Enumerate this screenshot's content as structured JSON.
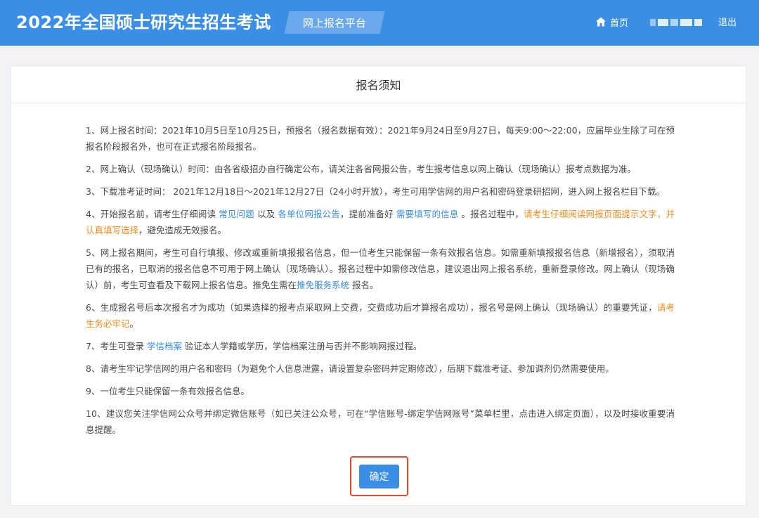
{
  "header": {
    "site_title": "2022年全国硕士研究生招生考试",
    "platform_label": "网上报名平台",
    "home_label": "首页",
    "logout_label": "退出"
  },
  "notice": {
    "title": "报名须知",
    "items": [
      {
        "segments": [
          {
            "text": "1、网上报名时间：2021年10月5日至10月25日，预报名（报名数据有效）：2021年9月24日至9月27日，每天9:00～22:00，应届毕业生除了可在预报名阶段报名外，也可在正式报名阶段报名。"
          }
        ]
      },
      {
        "segments": [
          {
            "text": "2、网上确认（现场确认）时间：由各省级招办自行确定公布，请关注各省网报公告，考生报考信息以网上确认（现场确认）报考点数据为准。"
          }
        ]
      },
      {
        "segments": [
          {
            "text": "3、下载准考证时间： 2021年12月18日～2021年12月27日（24小时开放），考生可用学信网的用户名和密码登录研招网，进入网上报名栏目下载。"
          }
        ]
      },
      {
        "segments": [
          {
            "text": "4、开始报名前，请考生仔细阅读 "
          },
          {
            "text": "常见问题",
            "type": "link"
          },
          {
            "text": " 以及 "
          },
          {
            "text": "各单位网报公告",
            "type": "link"
          },
          {
            "text": "，提前准备好 "
          },
          {
            "text": "需要填写的信息",
            "type": "link"
          },
          {
            "text": " 。报名过程中，"
          },
          {
            "text": "请考生仔细阅读网报页面提示文字，并认真填写选择",
            "type": "warn"
          },
          {
            "text": "，避免造成无效报名。"
          }
        ]
      },
      {
        "segments": [
          {
            "text": "5、网上报名期间，考生可自行填报、修改或重新填报报名信息，但一位考生只能保留一条有效报名信息。如需重新填报报名信息（新增报名），须取消已有的报名，已取消的报名信息不可用于网上确认（现场确认）。报名过程中如需修改信息，建议退出网上报名系统，重新登录修改。网上确认（现场确认）前，考生可查看及下载网上报名信息。推免生需在"
          },
          {
            "text": "推免服务系统",
            "type": "link"
          },
          {
            "text": " 报名。"
          }
        ]
      },
      {
        "segments": [
          {
            "text": "6、生成报名号后本次报名才为成功（如果选择的报考点采取网上交费，交费成功后才算报名成功），报名号是网上确认（现场确认）的重要凭证，"
          },
          {
            "text": "请考生务必牢记",
            "type": "warn"
          },
          {
            "text": "。"
          }
        ]
      },
      {
        "segments": [
          {
            "text": "7、考生可登录 "
          },
          {
            "text": "学信档案",
            "type": "link"
          },
          {
            "text": " 验证本人学籍或学历，学信档案注册与否并不影响网报过程。"
          }
        ]
      },
      {
        "segments": [
          {
            "text": "8、请考生牢记学信网的用户名和密码（为避免个人信息泄露，请设置复杂密码并定期修改），后期下载准考证、参加调剂仍然需要使用。"
          }
        ]
      },
      {
        "segments": [
          {
            "text": "9、一位考生只能保留一条有效报名信息。"
          }
        ]
      },
      {
        "segments": [
          {
            "text": "10、建议您关注学信网公众号并绑定微信账号（如已关注公众号，可在“学信账号-绑定学信网账号”菜单栏里，点击进入绑定页面），以及时接收重要消息提醒。"
          }
        ]
      }
    ]
  },
  "confirm_label": "确定",
  "colors": {
    "header_bg": "#3a8ee6",
    "link": "#3a8ee6",
    "warning": "#f08c1e",
    "highlight_border": "#e8482f"
  },
  "icons": {
    "home": "home-icon"
  }
}
